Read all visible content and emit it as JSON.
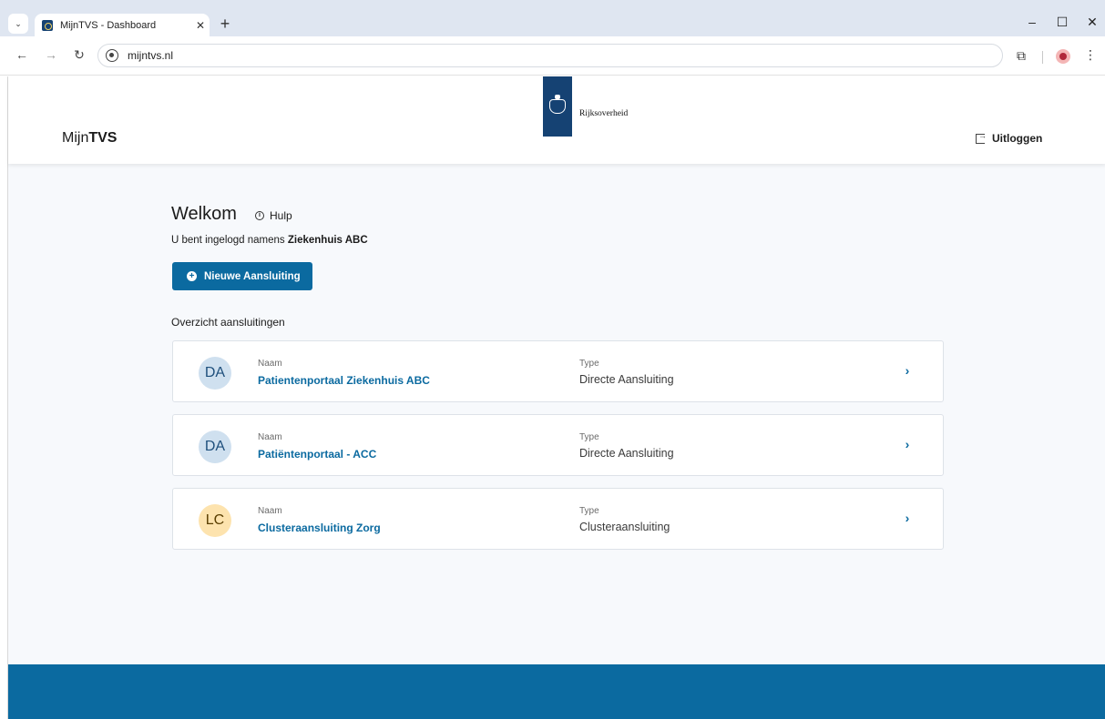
{
  "browser": {
    "tab_title": "MijnTVS - Dashboard",
    "tab_close": "✕",
    "new_tab": "+",
    "tab_menu": "⌄",
    "url": "mijntvs.nl",
    "back": "←",
    "forward": "→",
    "reload": "↻",
    "minimize": "–",
    "maximize": "☐",
    "close": "✕",
    "extensions": "⧉",
    "menu": "⋮"
  },
  "header": {
    "brand_prefix": "Mijn",
    "brand_bold": "TVS",
    "logo_text": "Rijksoverheid",
    "logout_label": "Uitloggen"
  },
  "main": {
    "welcome": "Welkom",
    "help_label": "Hulp",
    "logged_in_prefix": "U bent ingelogd namens ",
    "organization": "Ziekenhuis ABC",
    "new_connection_label": "Nieuwe Aansluiting",
    "section_title": "Overzicht aansluitingen"
  },
  "connections": [
    {
      "initials": "DA",
      "name_label": "Naam",
      "name": "Patientenportaal Ziekenhuis ABC",
      "type_label": "Type",
      "type": "Directe Aansluiting"
    },
    {
      "initials": "DA",
      "name_label": "Naam",
      "name": "Patiëntenportaal - ACC",
      "type_label": "Type",
      "type": "Directe Aansluiting"
    },
    {
      "initials": "LC",
      "name_label": "Naam",
      "name": "Clusteraansluiting Zorg",
      "type_label": "Type",
      "type": "Clusteraansluiting"
    }
  ],
  "icons": {
    "chevron": "›",
    "plus": "+",
    "help": "i"
  },
  "colors": {
    "primary": "#0b6aa0",
    "rijks_blue": "#154273",
    "avatar_da": "#cfe0ef",
    "avatar_lc": "#fde3ae",
    "page_bg": "#f7f9fc"
  }
}
